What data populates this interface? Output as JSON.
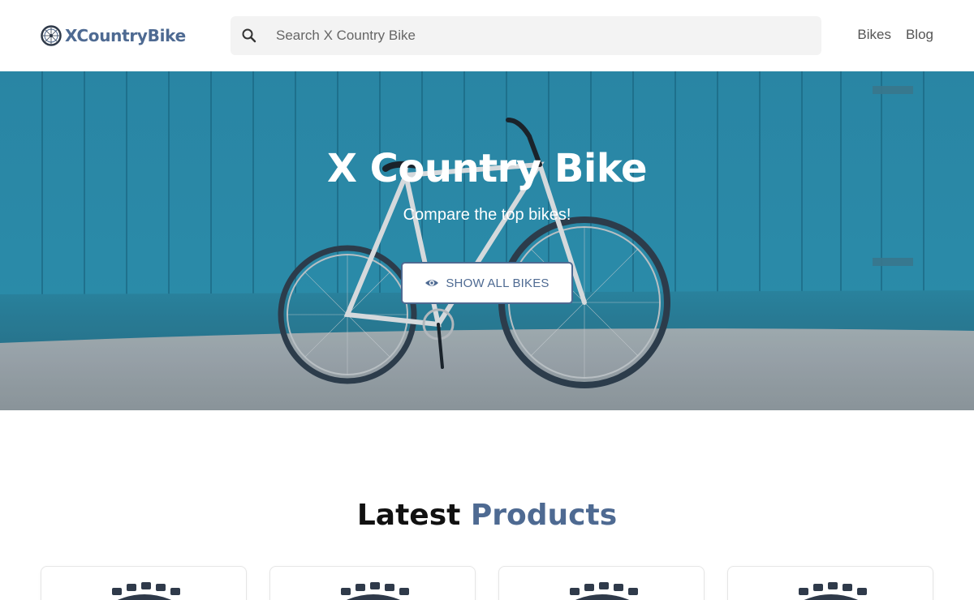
{
  "brand": {
    "name": "XCountryBike",
    "icon": "bike-wheel-icon",
    "color": "#4e6a92"
  },
  "search": {
    "placeholder": "Search X Country Bike",
    "icon": "search-icon"
  },
  "nav": [
    {
      "label": "Bikes"
    },
    {
      "label": "Blog"
    }
  ],
  "hero": {
    "title": "X Country Bike",
    "subtitle": "Compare the top bikes!",
    "button": {
      "label": "SHOW ALL BIKES",
      "icon": "eye-icon"
    }
  },
  "latest": {
    "title_part1": "Latest",
    "title_part2": "Products"
  },
  "products": [
    {
      "icon": "tire-icon"
    },
    {
      "icon": "tire-icon"
    },
    {
      "icon": "tire-icon"
    },
    {
      "icon": "tire-icon"
    }
  ],
  "colors": {
    "accent": "#4e6a92",
    "hero_wall": "#2f95b3",
    "tire": "#2f3a4a"
  }
}
